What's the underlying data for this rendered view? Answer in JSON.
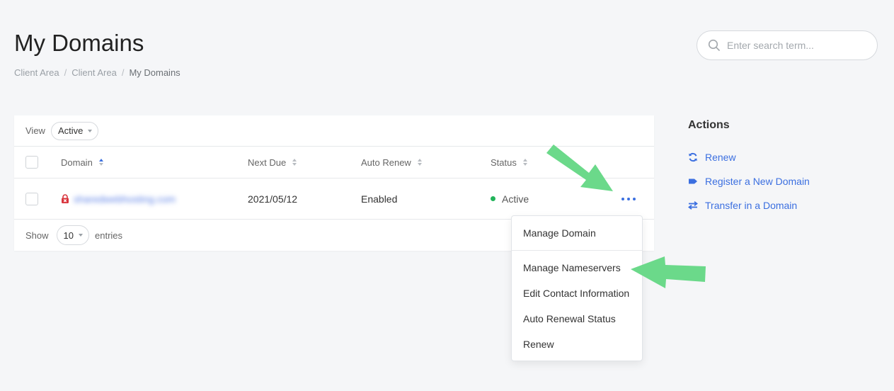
{
  "header": {
    "title": "My Domains",
    "breadcrumb": [
      "Client Area",
      "Client Area",
      "My Domains"
    ]
  },
  "search": {
    "placeholder": "Enter search term..."
  },
  "table": {
    "view_label": "View",
    "view_value": "Active",
    "columns": [
      "Domain",
      "Next Due",
      "Auto Renew",
      "Status"
    ],
    "rows": [
      {
        "domain": "sharedwebhosting.com",
        "next_due": "2021/05/12",
        "auto_renew": "Enabled",
        "status": "Active"
      }
    ],
    "show_label": "Show",
    "page_size": "10",
    "entries_label": "entries"
  },
  "dropdown": {
    "items": [
      "Manage Domain",
      "Manage Nameservers",
      "Edit Contact Information",
      "Auto Renewal Status",
      "Renew"
    ]
  },
  "actions": {
    "title": "Actions",
    "links": [
      {
        "label": "Renew",
        "icon": "refresh-icon"
      },
      {
        "label": "Register a New Domain",
        "icon": "tag-icon"
      },
      {
        "label": "Transfer in a Domain",
        "icon": "transfer-icon"
      }
    ]
  },
  "colors": {
    "accent": "#3b6fe0",
    "status_active": "#22b35a",
    "lock": "#d9363e",
    "arrow": "#6bd98a"
  }
}
